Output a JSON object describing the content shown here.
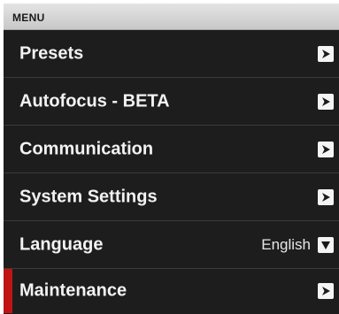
{
  "menu": {
    "title": "MENU",
    "items": [
      {
        "label": "Presets",
        "icon": "chevron-right-icon"
      },
      {
        "label": "Autofocus - BETA",
        "icon": "chevron-right-icon"
      },
      {
        "label": "Communication",
        "icon": "chevron-right-icon"
      },
      {
        "label": "System Settings",
        "icon": "chevron-right-icon"
      },
      {
        "label": "Language",
        "value": "English",
        "icon": "chevron-down-icon"
      },
      {
        "label": "Maintenance",
        "icon": "chevron-right-icon",
        "active": true
      }
    ]
  },
  "colors": {
    "header_bg": "#d6d6d6",
    "list_bg": "#1d1d1d",
    "divider": "#3a3a3a",
    "text": "#f2f2f2",
    "active_indicator": "#c01414",
    "button_bg": "#f4f4f4"
  }
}
